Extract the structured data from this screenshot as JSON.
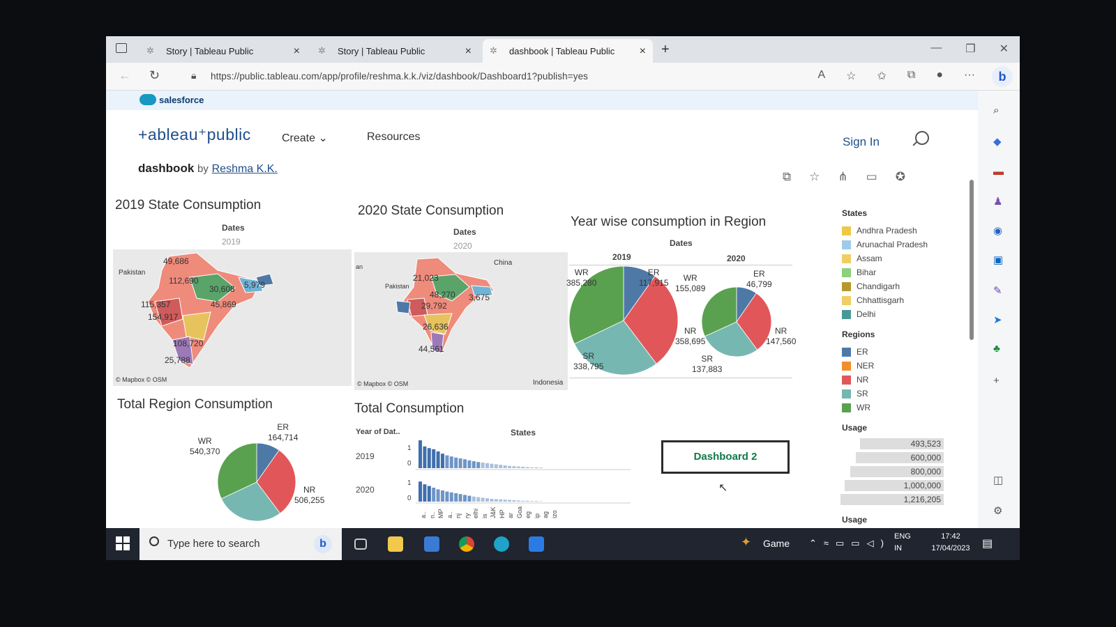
{
  "browser": {
    "tabs": [
      {
        "title": "Story | Tableau Public"
      },
      {
        "title": "Story | Tableau Public"
      },
      {
        "title": "dashbook | Tableau Public"
      }
    ],
    "url": "https://public.tableau.com/app/profile/reshma.k.k./viz/dashbook/Dashboard1?publish=yes",
    "bookmark": "salesforce"
  },
  "site": {
    "logo": "+ableau⁺public",
    "nav": {
      "create": "Create ⌄",
      "resources": "Resources"
    },
    "sign_in": "Sign In"
  },
  "viz": {
    "name": "dashbook",
    "by": "by",
    "author": "Reshma K.K."
  },
  "map2019": {
    "title": "2019 State Consumption",
    "dates_label": "Dates",
    "year": "2019",
    "labels": [
      "49,686",
      "112,690",
      "30,608",
      "5,979",
      "115,357",
      "45,869",
      "154,917",
      "108,720",
      "25,788"
    ],
    "country_label": "Pakistan",
    "credit": "© Mapbox  © OSM"
  },
  "map2020": {
    "title": "2020 State  Consumption",
    "dates_label": "Dates",
    "year": "2020",
    "labels": [
      "21,023",
      "48,270",
      "3,675",
      "29,792",
      "26,636",
      "44,561"
    ],
    "country_labels": [
      "Pakistan",
      "China",
      "Indonesia",
      "an"
    ],
    "credit": "© Mapbox  © OSM"
  },
  "yearwise": {
    "title": "Year wise consumption in Region",
    "dates_label": "Dates",
    "col2019": "2019",
    "col2020": "2020",
    "p2019": {
      "WR": "385,280",
      "ER": "117,915",
      "SR": "338,795",
      "NR": "358,695"
    },
    "p2020": {
      "WR": "155,089",
      "ER": "46,799",
      "SR": "137,883",
      "NR": "147,560"
    }
  },
  "total_region": {
    "title": "Total Region Consumption",
    "WR": "540,370",
    "ER": "164,714",
    "NR": "506,255"
  },
  "total": {
    "title": "Total Consumption",
    "col_header": "Year of Dat..",
    "states_header": "States",
    "rows": [
      "2019",
      "2020"
    ],
    "axis": [
      "1",
      "0"
    ],
    "state_abbr": [
      "a..",
      "n..",
      "MP",
      "a..",
      "nj",
      "ry",
      "elhi",
      "is",
      "J&K",
      "HP",
      "ar",
      "Goa",
      "eg",
      "ip",
      "ag",
      "izo"
    ]
  },
  "dashboard_button": "Dashboard 2",
  "legend": {
    "states_title": "States",
    "states": [
      "Andhra Pradesh",
      "Arunachal Pradesh",
      "Assam",
      "Bihar",
      "Chandigarh",
      "Chhattisgarh",
      "Delhi"
    ],
    "regions_title": "Regions",
    "regions": [
      "ER",
      "NER",
      "NR",
      "SR",
      "WR"
    ],
    "usage_title": "Usage",
    "usage": [
      "493,523",
      "600,000",
      "800,000",
      "1,000,000",
      "1,216,205"
    ],
    "usage2_title": "Usage"
  },
  "taskbar": {
    "search_placeholder": "Type here to search",
    "game": "Game",
    "lang": "ENG",
    "region": "IN",
    "time": "17:42",
    "date": "17/04/2023"
  },
  "colors": {
    "ER": "#4e79a7",
    "NER": "#f28e2b",
    "NR": "#e15759",
    "SR": "#76b7b2",
    "WR": "#59a14f",
    "state_colors": [
      "#edc948",
      "#a0cbe8",
      "#f1ce63",
      "#8cd17d",
      "#b6992d",
      "#f1ce63",
      "#499894"
    ]
  },
  "chart_data": [
    {
      "type": "pie",
      "title": "Year wise consumption in Region",
      "series": [
        {
          "name": "2019",
          "labels": [
            "ER",
            "NR",
            "SR",
            "WR"
          ],
          "values": [
            117915,
            358695,
            338795,
            385280
          ]
        },
        {
          "name": "2020",
          "labels": [
            "ER",
            "NR",
            "SR",
            "WR"
          ],
          "values": [
            46799,
            147560,
            137883,
            155089
          ]
        }
      ]
    },
    {
      "type": "pie",
      "title": "Total Region Consumption",
      "labels": [
        "ER",
        "NR",
        "SR",
        "WR"
      ],
      "values": [
        164714,
        506255,
        476678,
        540370
      ]
    },
    {
      "type": "bar",
      "title": "Total Consumption",
      "categories": [
        "2019",
        "2020"
      ],
      "series": [
        {
          "name": "2019",
          "values": [
            1,
            0.78,
            0.72,
            0.68,
            0.6,
            0.52,
            0.46,
            0.42,
            0.38,
            0.35,
            0.32,
            0.28,
            0.25,
            0.22,
            0.2,
            0.18,
            0.16,
            0.14,
            0.12,
            0.1,
            0.08,
            0.07,
            0.06,
            0.05,
            0.04,
            0.03,
            0.03,
            0.02
          ]
        },
        {
          "name": "2020",
          "values": [
            0.72,
            0.62,
            0.56,
            0.5,
            0.44,
            0.4,
            0.36,
            0.33,
            0.3,
            0.27,
            0.24,
            0.21,
            0.18,
            0.16,
            0.14,
            0.12,
            0.1,
            0.09,
            0.08,
            0.07,
            0.06,
            0.05,
            0.04,
            0.03,
            0.03,
            0.02,
            0.02,
            0.01
          ]
        }
      ],
      "ylim": [
        0,
        1
      ]
    }
  ]
}
